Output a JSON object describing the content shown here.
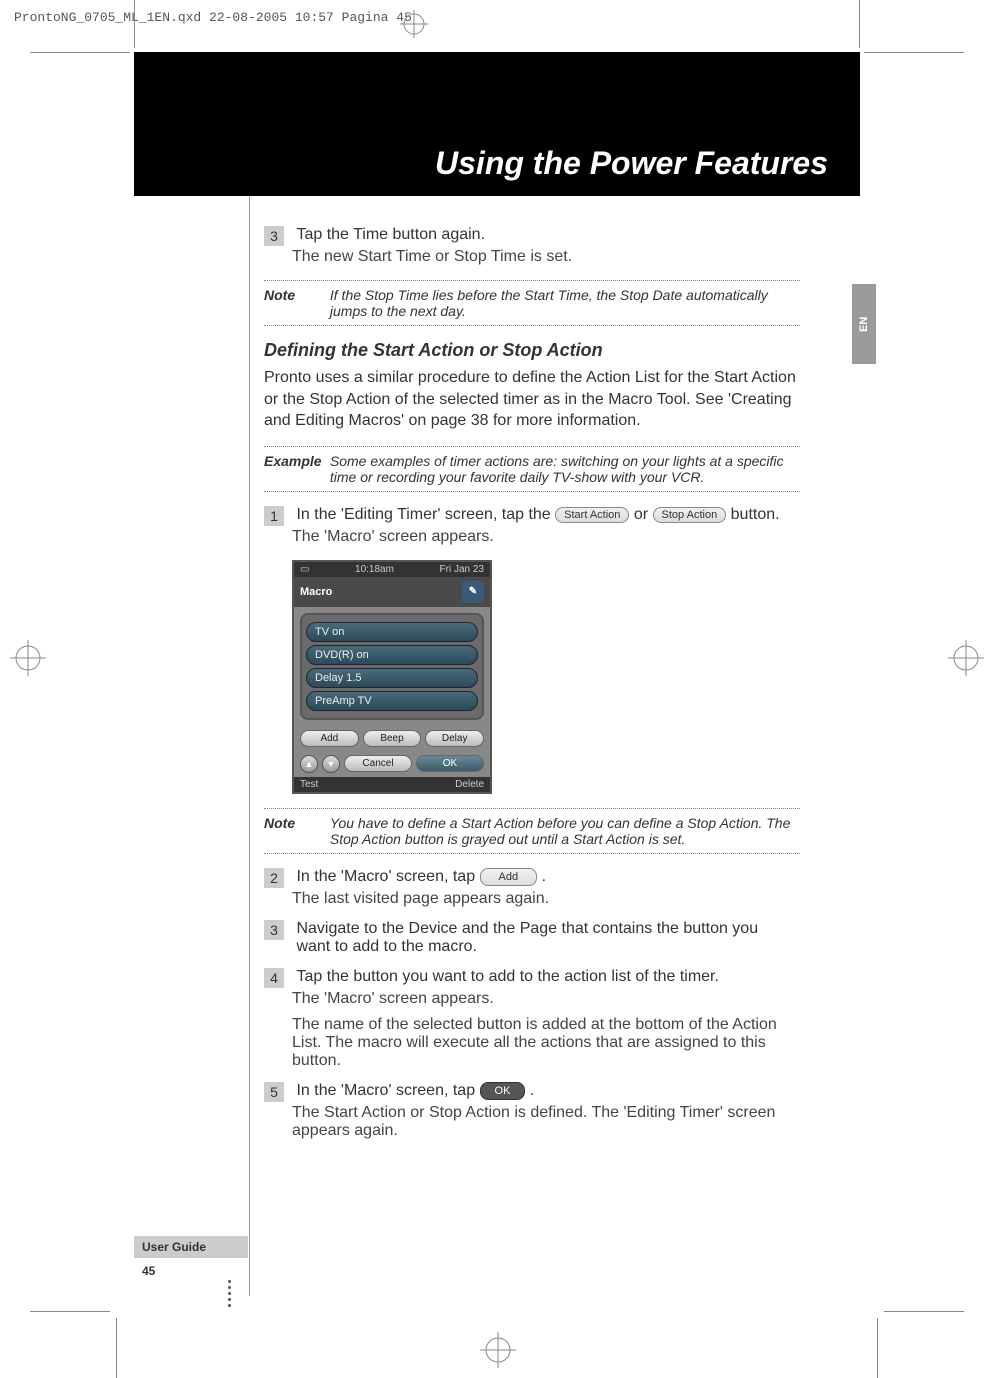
{
  "file_header": "ProntoNG_0705_ML_1EN.qxd   22-08-2005   10:57   Pagina 45",
  "banner_title": "Using the Power Features",
  "side_tab": "EN",
  "step3_num": "3",
  "step3_title": "Tap the Time button again.",
  "step3_sub": "The new Start Time or Stop Time is set.",
  "note1_label": "Note",
  "note1_text": "If the Stop Time lies before the Start Time, the Stop Date automatically jumps to the next day.",
  "subhead": "Defining the Start Action or Stop Action",
  "body1": "Pronto uses a similar procedure to define the Action List for the Start Action or the Stop Action of the selected timer as in the Macro Tool. See 'Creating and Editing Macros' on page 38 for more information.",
  "example_label": "Example",
  "example_text": "Some examples of timer actions are: switching on your lights at a specific time or recording your favorite daily TV-show with your VCR.",
  "step1_num": "1",
  "step1_prefix": "In the 'Editing Timer' screen, tap the ",
  "btn_start_action": "Start Action",
  "step1_mid": " or ",
  "btn_stop_action": "Stop Action",
  "step1_suffix": " button.",
  "step1_sub": "The 'Macro' screen appears.",
  "macro": {
    "time": "10:18am",
    "date": "Fri Jan 23",
    "title": "Macro",
    "items": [
      "TV on",
      "DVD(R) on",
      "Delay 1.5",
      "PreAmp TV"
    ],
    "btn_add": "Add",
    "btn_beep": "Beep",
    "btn_delay": "Delay",
    "btn_cancel": "Cancel",
    "btn_ok": "OK",
    "footer_test": "Test",
    "footer_delete": "Delete"
  },
  "note2_label": "Note",
  "note2_text": "You have to define a Start Action before you can define a Stop Action. The Stop Action button is grayed out until a Start Action is set.",
  "step2_num": "2",
  "step2_prefix": "In the 'Macro' screen, tap ",
  "btn_add_pill": "Add",
  "step2_suffix": ".",
  "step2_sub": "The last visited page appears again.",
  "step3b_num": "3",
  "step3b_title": "Navigate to the Device and the Page that contains the button you want to add to the macro.",
  "step4_num": "4",
  "step4_title": "Tap the button you want to add to the action list of the timer.",
  "step4_sub1": "The 'Macro' screen appears.",
  "step4_sub2": "The name of the selected button is added at the bottom of the Action List. The macro will execute all the actions that are assigned to this button.",
  "step5_num": "5",
  "step5_prefix": "In the 'Macro' screen, tap ",
  "btn_ok_pill": "OK",
  "step5_suffix": ".",
  "step5_sub": "The Start Action or Stop Action is defined. The 'Editing Timer' screen appears again.",
  "user_guide": "User Guide",
  "page_num": "45"
}
